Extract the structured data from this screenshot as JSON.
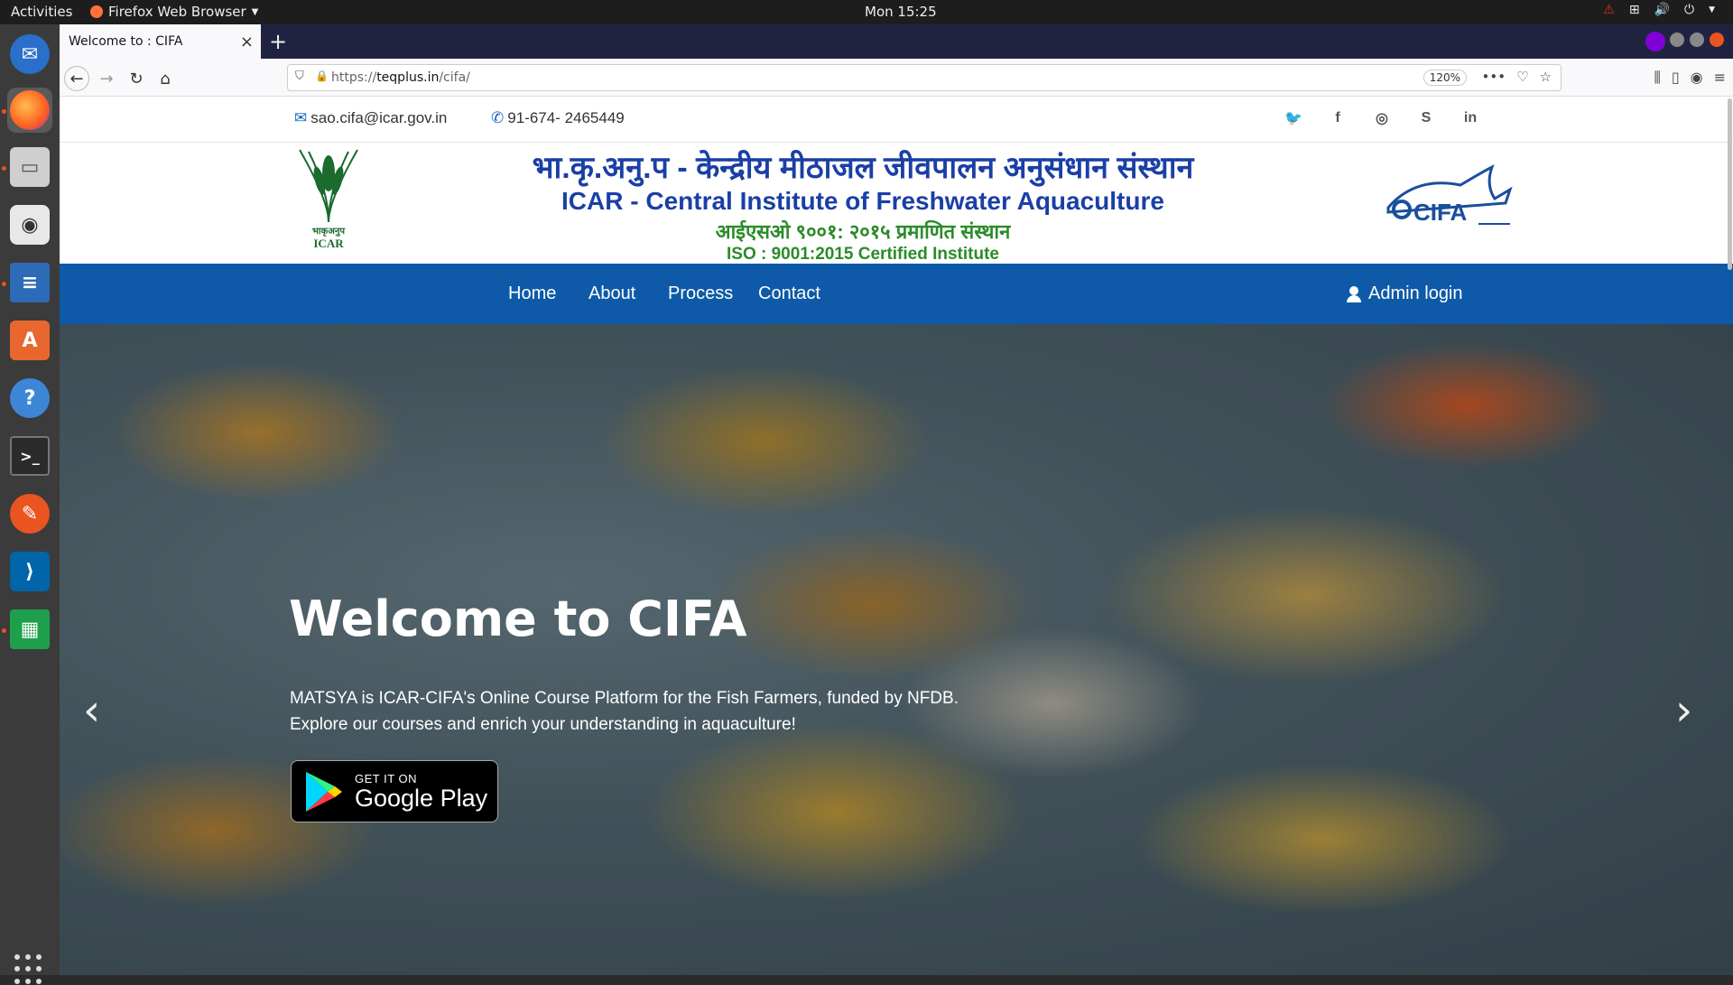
{
  "topbar": {
    "activities": "Activities",
    "app_name": "Firefox Web Browser",
    "clock": "Mon 15:25"
  },
  "browser": {
    "tab_title": "Welcome to : CIFA",
    "url_prefix": "https://",
    "url_host": "teqplus.in",
    "url_path": "/cifa/",
    "zoom": "120%"
  },
  "site": {
    "email": "sao.cifa@icar.gov.in",
    "phone": "91-674- 2465449",
    "social": [
      "twitter",
      "facebook",
      "instagram",
      "skype",
      "linkedin"
    ],
    "logo_left_hi": "भाकृअनुप",
    "logo_left_en": "ICAR",
    "banner_hindi": "भा.कृ.अनु.प - केन्द्रीय मीठाजल जीवपालन अनुसंधान संस्थान",
    "banner_english": "ICAR - Central Institute of Freshwater Aquaculture",
    "banner_hindi_iso": "आईएसओ ९००१: २०१५ प्रमाणित संस्थान",
    "banner_iso": "ISO : 9001:2015 Certified Institute",
    "logo_right": "CIFA",
    "nav": {
      "home": "Home",
      "about": "About",
      "process": "Process",
      "contact": "Contact",
      "admin": "Admin login"
    },
    "hero": {
      "title": "Welcome to CIFA",
      "text_line1": "MATSYA is ICAR-CIFA's Online Course Platform for the Fish Farmers, funded by NFDB.",
      "text_line2": "Explore our courses and enrich your understanding in aquaculture!",
      "badge_small": "GET IT ON",
      "badge_big": "Google Play"
    }
  },
  "colors": {
    "nav_blue": "#0f5aa8",
    "banner_blue": "#1a3fa6",
    "banner_green": "#2a8c2a",
    "ubuntu_orange": "#e95420"
  }
}
